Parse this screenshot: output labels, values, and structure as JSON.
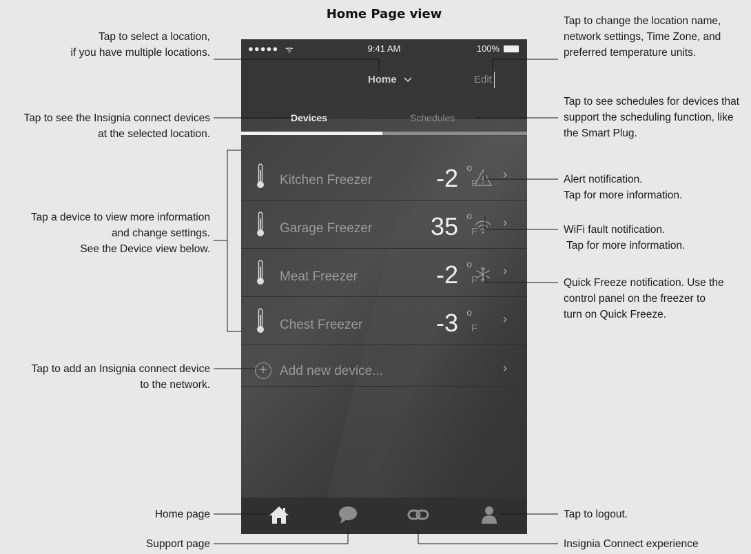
{
  "title": "Home Page view",
  "status_bar": {
    "signal": "●●●●●",
    "wifi": "ᯤ",
    "time": "9:41 AM",
    "battery": "100%"
  },
  "header": {
    "location": "Home",
    "edit_label": "Edit"
  },
  "tabs": {
    "devices": "Devices",
    "schedules": "Schedules"
  },
  "devices": [
    {
      "name": "Kitchen Freezer",
      "temp": "-2",
      "deg": "o",
      "unit": "F",
      "status": "alert-triangle-icon"
    },
    {
      "name": "Garage Freezer",
      "temp": "35",
      "deg": "o",
      "unit": "F",
      "status": "wifi-fault-icon"
    },
    {
      "name": "Meat Freezer",
      "temp": "-2",
      "deg": "o",
      "unit": "F",
      "status": "snowflake-icon"
    },
    {
      "name": "Chest Freezer",
      "temp": "-3",
      "deg": "o",
      "unit": "F",
      "status": ""
    }
  ],
  "add_device": {
    "label": "Add new device...",
    "plus": "+"
  },
  "chevron": "›",
  "nav": [
    "home-icon",
    "support-chat-icon",
    "link-icon",
    "user-icon"
  ],
  "callouts": {
    "select_location": [
      "Tap to select a location,",
      "if you have multiple locations."
    ],
    "see_devices": [
      "Tap to see the Insignia connect devices",
      "at the selected location."
    ],
    "device_view": [
      "Tap a device to view more information",
      "and change settings.",
      "See the Device view below."
    ],
    "add_device": [
      "Tap to add an Insignia connect device",
      "to the network."
    ],
    "home_page": [
      "Home page"
    ],
    "support_page": [
      "Support page"
    ],
    "change_location": [
      "Tap to change the location name,",
      "network settings, Time Zone, and",
      "preferred temperature units."
    ],
    "schedules": [
      "Tap to see schedules for devices that",
      "support the scheduling function, like",
      "the Smart Plug."
    ],
    "alert": [
      "Alert notification.",
      "Tap for more information."
    ],
    "wifi_fault": [
      "WiFi fault notification.",
      " Tap for more information."
    ],
    "quick_freeze": [
      "Quick Freeze notification. Use the",
      "control panel on the freezer to",
      "turn on Quick Freeze."
    ],
    "logout": [
      "Tap to logout."
    ],
    "connect": [
      "Insignia Connect experience"
    ]
  }
}
